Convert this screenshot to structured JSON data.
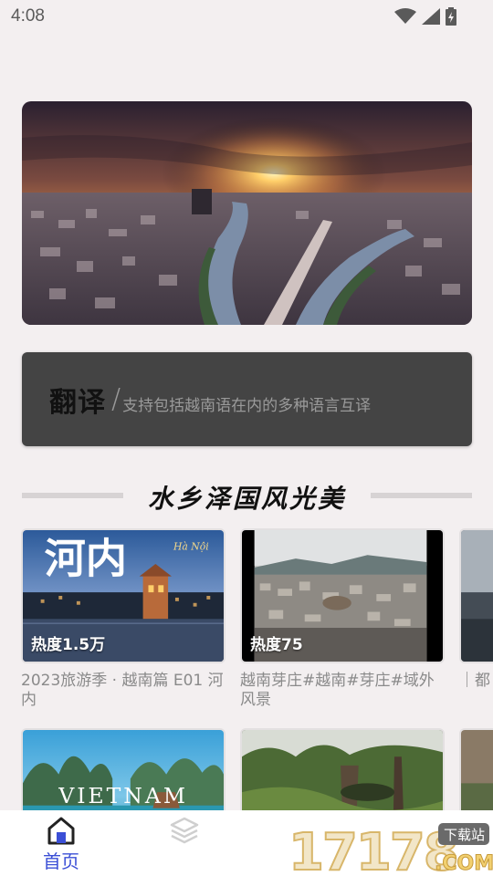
{
  "status_bar": {
    "time": "4:08",
    "icons": [
      "wifi-icon",
      "cell-signal-icon",
      "battery-icon"
    ]
  },
  "banner": {
    "image": "Sunset over a city with river canals"
  },
  "translate": {
    "title": "翻译",
    "slash": "/",
    "description": "支持包括越南语在内的多种语言互译"
  },
  "section": {
    "title": "水乡泽国风光美"
  },
  "cards": [
    {
      "heat": "热度1.5万",
      "title": "2023旅游季 · 越南篇  E01 河内",
      "overlay_text": "河内",
      "overlay_sub": "Hà Nội"
    },
    {
      "heat": "热度75",
      "title": "越南芽庄#越南#芽庄#域外风景"
    },
    {
      "heat": "",
      "title": "｜都"
    },
    {
      "heat": "",
      "title": "",
      "overlay_text": "VIETNAM"
    },
    {
      "heat": "",
      "title": ""
    }
  ],
  "bottom_nav": {
    "items": [
      {
        "label": "首页",
        "icon": "home-icon",
        "active": true
      },
      {
        "label": "",
        "icon": "layers-icon",
        "active": false
      }
    ]
  },
  "watermark": {
    "number": "17178",
    "tag": "下载站",
    "suffix": ".COM"
  },
  "colors": {
    "background": "#f3eff0",
    "accent": "#3b4fd6",
    "translate_card": "#444444"
  }
}
